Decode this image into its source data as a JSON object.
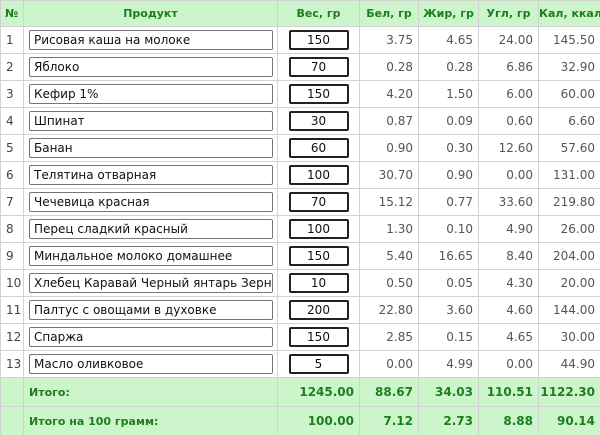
{
  "headers": {
    "idx": "№",
    "product": "Продукт",
    "weight": "Вес, гр",
    "protein": "Бел, гр",
    "fat": "Жир, гр",
    "carbs": "Угл, гр",
    "kcal": "Кал, ккал"
  },
  "rows": [
    {
      "idx": "1",
      "name": "Рисовая каша на молоке",
      "weight": "150",
      "protein": "3.75",
      "fat": "4.65",
      "carbs": "24.00",
      "kcal": "145.50"
    },
    {
      "idx": "2",
      "name": "Яблоко",
      "weight": "70",
      "protein": "0.28",
      "fat": "0.28",
      "carbs": "6.86",
      "kcal": "32.90"
    },
    {
      "idx": "3",
      "name": "Кефир 1%",
      "weight": "150",
      "protein": "4.20",
      "fat": "1.50",
      "carbs": "6.00",
      "kcal": "60.00"
    },
    {
      "idx": "4",
      "name": "Шпинат",
      "weight": "30",
      "protein": "0.87",
      "fat": "0.09",
      "carbs": "0.60",
      "kcal": "6.60"
    },
    {
      "idx": "5",
      "name": "Банан",
      "weight": "60",
      "protein": "0.90",
      "fat": "0.30",
      "carbs": "12.60",
      "kcal": "57.60"
    },
    {
      "idx": "6",
      "name": "Телятина отварная",
      "weight": "100",
      "protein": "30.70",
      "fat": "0.90",
      "carbs": "0.00",
      "kcal": "131.00"
    },
    {
      "idx": "7",
      "name": "Чечевица красная",
      "weight": "70",
      "protein": "15.12",
      "fat": "0.77",
      "carbs": "33.60",
      "kcal": "219.80"
    },
    {
      "idx": "8",
      "name": "Перец сладкий красный",
      "weight": "100",
      "protein": "1.30",
      "fat": "0.10",
      "carbs": "4.90",
      "kcal": "26.00"
    },
    {
      "idx": "9",
      "name": "Миндальное молоко домашнее",
      "weight": "150",
      "protein": "5.40",
      "fat": "16.65",
      "carbs": "8.40",
      "kcal": "204.00"
    },
    {
      "idx": "10",
      "name": "Хлебец Каравай Черный янтарь Зерно и сол",
      "weight": "10",
      "protein": "0.50",
      "fat": "0.05",
      "carbs": "4.30",
      "kcal": "20.00"
    },
    {
      "idx": "11",
      "name": "Палтус с овощами в духовке",
      "weight": "200",
      "protein": "22.80",
      "fat": "3.60",
      "carbs": "4.60",
      "kcal": "144.00"
    },
    {
      "idx": "12",
      "name": "Спаржа",
      "weight": "150",
      "protein": "2.85",
      "fat": "0.15",
      "carbs": "4.65",
      "kcal": "30.00"
    },
    {
      "idx": "13",
      "name": "Масло оливковое",
      "weight": "5",
      "protein": "0.00",
      "fat": "4.99",
      "carbs": "0.00",
      "kcal": "44.90"
    }
  ],
  "totals": {
    "label": "Итого:",
    "weight": "1245.00",
    "protein": "88.67",
    "fat": "34.03",
    "carbs": "110.51",
    "kcal": "1122.30"
  },
  "per100": {
    "label": "Итого на 100 грамм:",
    "weight": "100.00",
    "protein": "7.12",
    "fat": "2.73",
    "carbs": "8.88",
    "kcal": "90.14"
  },
  "colors": {
    "header_bg": "#ccf5cc",
    "header_text": "#1e7e1e",
    "grid_border": "#d2d2d2"
  }
}
